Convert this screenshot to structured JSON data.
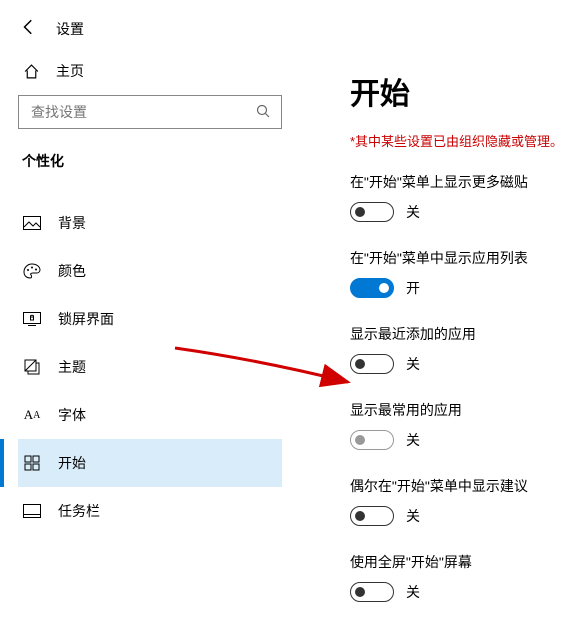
{
  "header": {
    "title": "设置"
  },
  "sidebar": {
    "home_label": "主页",
    "search_placeholder": "查找设置",
    "section_label": "个性化",
    "items": [
      {
        "label": "背景"
      },
      {
        "label": "颜色"
      },
      {
        "label": "锁屏界面"
      },
      {
        "label": "主题"
      },
      {
        "label": "字体"
      },
      {
        "label": "开始"
      },
      {
        "label": "任务栏"
      }
    ]
  },
  "main": {
    "title": "开始",
    "warning": "*其中某些设置已由组织隐藏或管理。",
    "on_text": "开",
    "off_text": "关",
    "settings": [
      {
        "label": "在\"开始\"菜单上显示更多磁贴"
      },
      {
        "label": "在\"开始\"菜单中显示应用列表"
      },
      {
        "label": "显示最近添加的应用"
      },
      {
        "label": "显示最常用的应用"
      },
      {
        "label": "偶尔在\"开始\"菜单中显示建议"
      },
      {
        "label": "使用全屏\"开始\"屏幕"
      }
    ]
  }
}
